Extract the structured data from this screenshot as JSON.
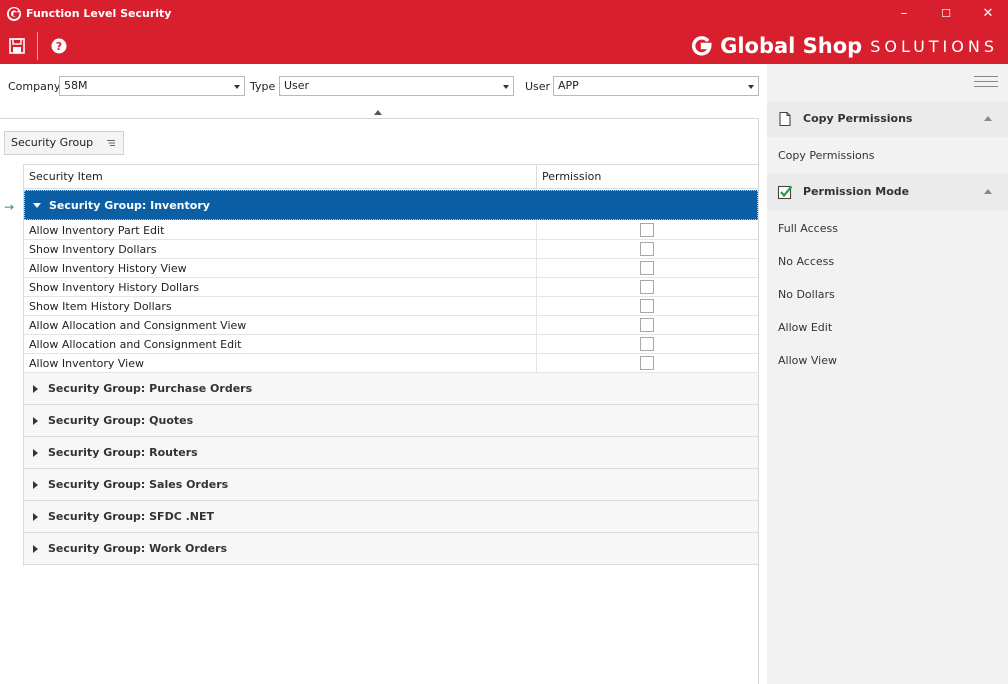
{
  "window": {
    "title": "Function Level Security",
    "minimize": "–",
    "maximize": "☐",
    "close": "✕"
  },
  "brand": {
    "bold": "Global Shop",
    "light": "SOLUTIONS",
    "color": "#d81f2e"
  },
  "toolbar": {
    "save_icon": "save-icon",
    "help_icon": "help-icon"
  },
  "filters": {
    "company_label": "Company",
    "company_value": "58M",
    "type_label": "Type",
    "type_value": "User",
    "user_label": "User",
    "user_value": "APP"
  },
  "grid": {
    "group_by_chip": "Security Group",
    "columns": [
      "Security Item",
      "Permission"
    ],
    "expanded_group": "Security Group: Inventory",
    "items": [
      "Allow Inventory Part Edit",
      "Show Inventory Dollars",
      "Allow Inventory History View",
      "Show Inventory History Dollars",
      "Show Item History Dollars",
      "Allow Allocation and Consignment View",
      "Allow Allocation and Consignment Edit",
      "Allow Inventory View"
    ],
    "collapsed_groups": [
      "Security Group: Purchase Orders",
      "Security Group: Quotes",
      "Security Group: Routers",
      "Security Group: Sales Orders",
      "Security Group: SFDC .NET",
      "Security Group: Work Orders"
    ],
    "selected_color": "#0c5fa4"
  },
  "panel": {
    "copy_header": "Copy Permissions",
    "copy_items": [
      "Copy Permissions"
    ],
    "mode_header": "Permission Mode",
    "mode_items": [
      "Full Access",
      "No Access",
      "No Dollars",
      "Allow Edit",
      "Allow View"
    ]
  }
}
